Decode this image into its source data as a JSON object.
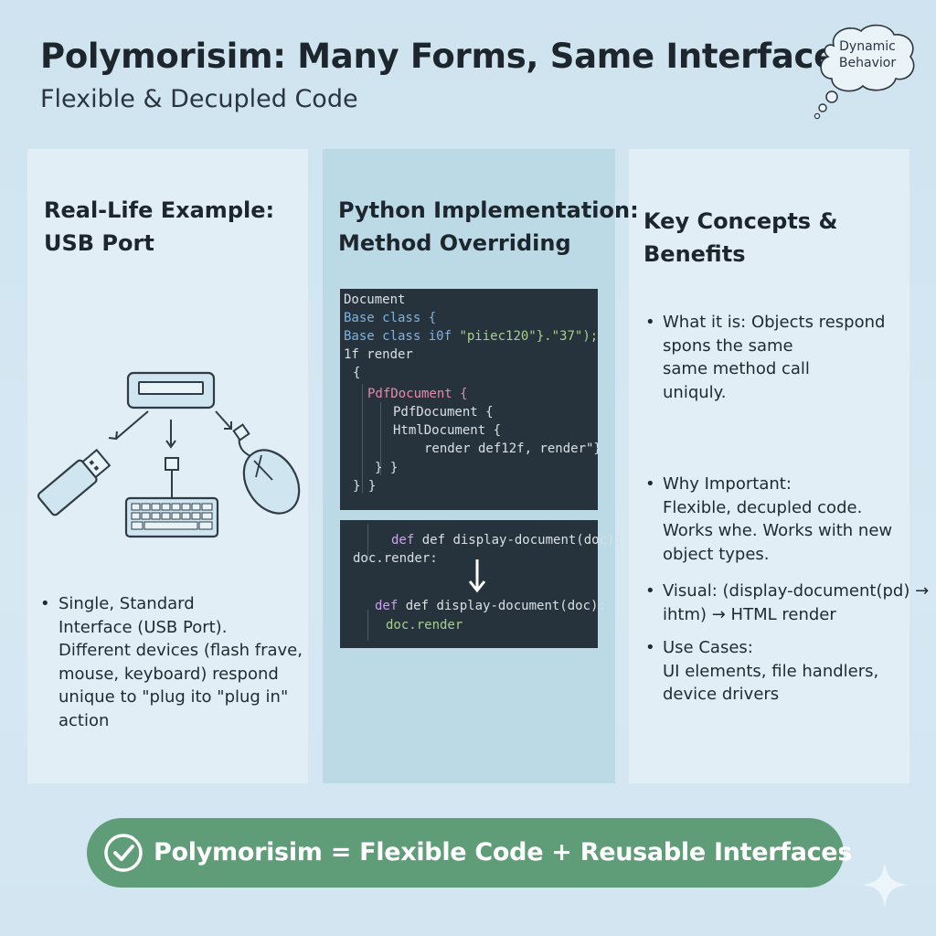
{
  "title": "Polymorisim: Many Forms, Same Interface",
  "subtitle": "Flexible & Decupled Code",
  "thought_bubble": {
    "line1": "Dynamic",
    "line2": "Behavior"
  },
  "left_panel": {
    "heading_line1": "Real-Life Example:",
    "heading_line2": "USB Port",
    "bullet_lines": [
      "Single, Standard",
      "Interface (USB Port).",
      "Different devices (flash frave,",
      "mouse, keyboard) respond",
      "unique to \"plug ito \"plug in\"",
      "action"
    ]
  },
  "middle_panel": {
    "heading_line1": "Python Implementation:",
    "heading_line2": "Method Overriding",
    "code_a": {
      "l1": "Document",
      "l2": "Base class {",
      "l3a": "Base class i0f",
      "l3b": "\"piiec120\"}.\"37\");",
      "l4": "1f render",
      "l5": "{",
      "l6": "PdfDocument {",
      "l7": "PdfDocument {",
      "l8": "HtmlDocument {",
      "l9": "render def12f, render\"}",
      "l10": "} }",
      "l11": "} }"
    },
    "code_b": {
      "l1": "def display-document(doc):",
      "l2": "doc.render:",
      "l3": "def display-document(doc):",
      "l4": "doc.render"
    }
  },
  "right_panel": {
    "heading_line1": "Key Concepts &",
    "heading_line2": "Benefits",
    "bullets": [
      {
        "lines": [
          "What it is: Objects respond",
          "spons the same",
          "same method call",
          "uniquly."
        ]
      },
      {
        "lines": [
          "Why Important:",
          "Flexible, decupled code.",
          "Works whe. Works with new",
          "object types."
        ]
      },
      {
        "lines": [
          "Visual: (display-document(pd) →",
          "ihtm) → HTML render"
        ]
      },
      {
        "lines": [
          "Use Cases:",
          "UI elements, file handlers,",
          "device drivers"
        ]
      }
    ]
  },
  "banner": {
    "text": "Polymorisim = Flexible Code + Reusable Interfaces"
  },
  "colors": {
    "background": "#d2e5f1",
    "panel_side": "#e1eef6",
    "panel_middle": "#bcd9e6",
    "code_bg": "#26333c",
    "banner": "#5f9c78",
    "code_blue": "#7fb2e0",
    "code_green": "#a8d08d",
    "code_pink": "#e58aa7"
  },
  "icons": [
    "thought-bubble-icon",
    "usb-port-icon",
    "flash-drive-icon",
    "keyboard-icon",
    "mouse-icon",
    "down-arrow-icon",
    "check-circle-icon",
    "sparkle-icon"
  ]
}
